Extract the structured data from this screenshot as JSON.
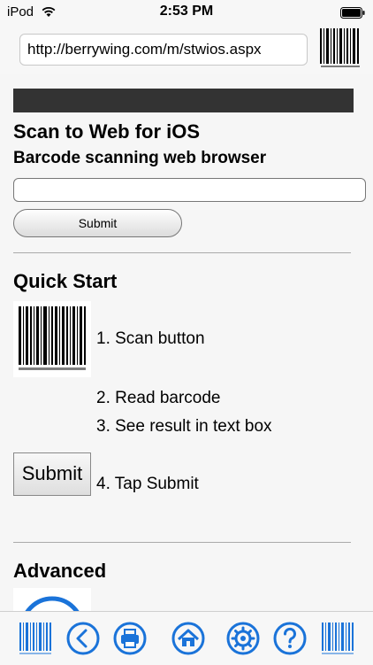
{
  "status_bar": {
    "carrier": "iPod",
    "time": "2:53 PM"
  },
  "browser": {
    "url": "http://berrywing.com/m/stwios.aspx"
  },
  "page": {
    "title": "Scan to Web for iOS",
    "subtitle": "Barcode scanning web browser",
    "text_box_value": "",
    "submit_label": "Submit",
    "quick_start": {
      "heading": "Quick Start",
      "steps": [
        "1. Scan button",
        "2. Read barcode",
        "3. See result in text box",
        "4. Tap Submit"
      ],
      "submit_example_label": "Submit"
    },
    "advanced_heading": "Advanced"
  },
  "toolbar": {
    "items": [
      "barcode-scan-icon",
      "back-icon",
      "print-icon",
      "home-icon",
      "settings-icon",
      "help-icon",
      "barcode-scan-icon"
    ]
  },
  "colors": {
    "accent": "#1a73d9",
    "band": "#333333"
  }
}
